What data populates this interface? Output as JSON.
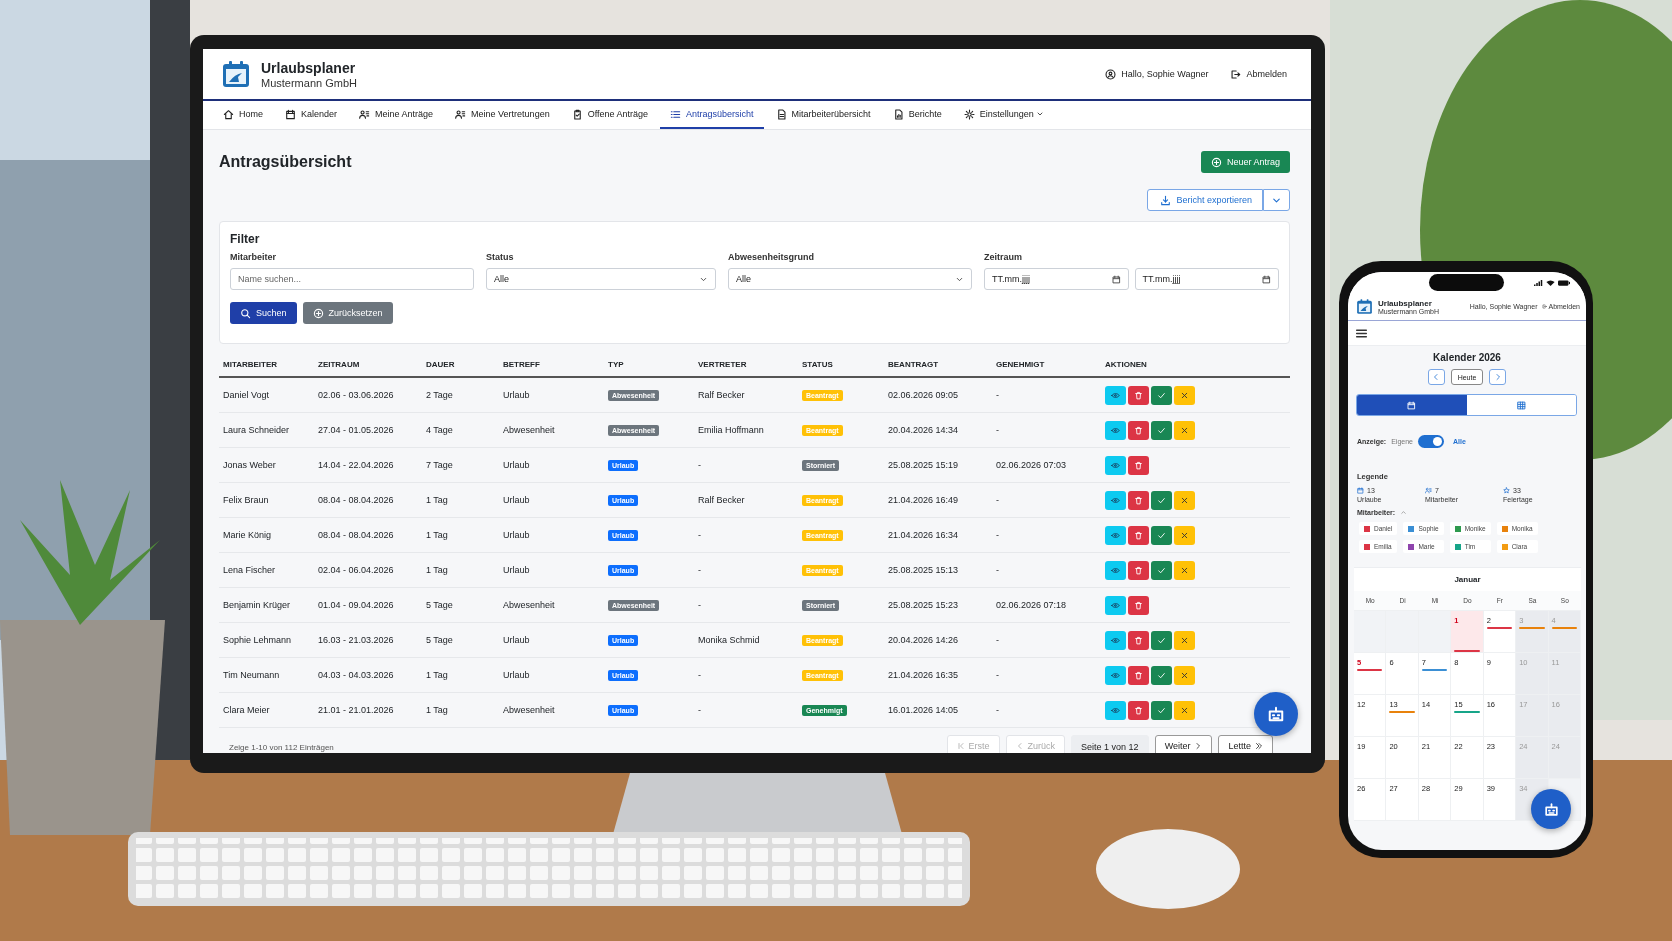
{
  "app": {
    "title": "Urlaubsplaner",
    "company": "Mustermann GmbH",
    "greeting": "Hallo, Sophie Wagner",
    "logout": "Abmelden"
  },
  "nav": [
    {
      "label": "Home",
      "selected": false,
      "dropdown": false
    },
    {
      "label": "Kalender",
      "selected": false,
      "dropdown": false
    },
    {
      "label": "Meine Anträge",
      "selected": false,
      "dropdown": false
    },
    {
      "label": "Meine Vertretungen",
      "selected": false,
      "dropdown": false
    },
    {
      "label": "Offene Anträge",
      "selected": false,
      "dropdown": false
    },
    {
      "label": "Antragsübersicht",
      "selected": true,
      "dropdown": false
    },
    {
      "label": "Mitarbeiterübersicht",
      "selected": false,
      "dropdown": false
    },
    {
      "label": "Berichte",
      "selected": false,
      "dropdown": false
    },
    {
      "label": "Einstellungen",
      "selected": false,
      "dropdown": true
    }
  ],
  "page": {
    "title": "Antragsübersicht",
    "new_button": "Neuer Antrag",
    "export_button": "Bericht exportieren"
  },
  "filter": {
    "title": "Filter",
    "fields": [
      {
        "kind": "text",
        "label": "Mitarbeiter",
        "placeholder": "Name suchen..."
      },
      {
        "kind": "select",
        "label": "Status",
        "value": "Alle"
      },
      {
        "kind": "select",
        "label": "Abwesenheitsgrund",
        "value": "Alle"
      },
      {
        "kind": "daterange",
        "label": "Zeitraum",
        "from_placeholder": "TT.mm.jjjj",
        "to_placeholder": "TT.mm.jjjj"
      }
    ],
    "search_button": "Suchen",
    "reset_button": "Zurücksetzen"
  },
  "table": {
    "columns": [
      "MITARBEITER",
      "ZEITRAUM",
      "DAUER",
      "BETREFF",
      "TYP",
      "VERTRETER",
      "STATUS",
      "BEANTRAGT",
      "GENEHMIGT",
      "AKTIONEN"
    ],
    "rows": [
      {
        "mitarbeiter": "Daniel Vogt",
        "zeitraum": "02.06 - 03.06.2026",
        "dauer": "2 Tage",
        "betreff": "Urlaub",
        "typ": {
          "label": "Abwesenheit",
          "color": "#6c757d"
        },
        "vertreter": "Ralf Becker",
        "status": {
          "label": "Beantragt",
          "color": "#ffc107"
        },
        "beantragt": "02.06.2026 09:05",
        "genehmigt": "-",
        "actions": [
          {
            "kind": "view"
          },
          {
            "kind": "delete"
          },
          {
            "kind": "approve"
          },
          {
            "kind": "reject"
          }
        ]
      },
      {
        "mitarbeiter": "Laura Schneider",
        "zeitraum": "27.04 - 01.05.2026",
        "dauer": "4 Tage",
        "betreff": "Abwesenheit",
        "typ": {
          "label": "Abwesenheit",
          "color": "#6c757d"
        },
        "vertreter": "Emilia Hoffmann",
        "status": {
          "label": "Beantragt",
          "color": "#ffc107"
        },
        "beantragt": "20.04.2026 14:34",
        "genehmigt": "-",
        "actions": [
          {
            "kind": "view"
          },
          {
            "kind": "delete"
          },
          {
            "kind": "approve"
          },
          {
            "kind": "reject"
          }
        ]
      },
      {
        "mitarbeiter": "Jonas Weber",
        "zeitraum": "14.04 - 22.04.2026",
        "dauer": "7 Tage",
        "betreff": "Urlaub",
        "typ": {
          "label": "Urlaub",
          "color": "#0d6efd"
        },
        "vertreter": "-",
        "status": {
          "label": "Storniert",
          "color": "#6c757d"
        },
        "beantragt": "25.08.2025 15:19",
        "genehmigt": "02.06.2026 07:03",
        "actions": [
          {
            "kind": "view"
          },
          {
            "kind": "delete"
          }
        ]
      },
      {
        "mitarbeiter": "Felix Braun",
        "zeitraum": "08.04 - 08.04.2026",
        "dauer": "1 Tag",
        "betreff": "Urlaub",
        "typ": {
          "label": "Urlaub",
          "color": "#0d6efd"
        },
        "vertreter": "Ralf Becker",
        "status": {
          "label": "Beantragt",
          "color": "#ffc107"
        },
        "beantragt": "21.04.2026 16:49",
        "genehmigt": "-",
        "actions": [
          {
            "kind": "view"
          },
          {
            "kind": "delete"
          },
          {
            "kind": "approve"
          },
          {
            "kind": "reject"
          }
        ]
      },
      {
        "mitarbeiter": "Marie König",
        "zeitraum": "08.04 - 08.04.2026",
        "dauer": "1 Tag",
        "betreff": "Urlaub",
        "typ": {
          "label": "Urlaub",
          "color": "#0d6efd"
        },
        "vertreter": "-",
        "status": {
          "label": "Beantragt",
          "color": "#ffc107"
        },
        "beantragt": "21.04.2026 16:34",
        "genehmigt": "-",
        "actions": [
          {
            "kind": "view"
          },
          {
            "kind": "delete"
          },
          {
            "kind": "approve"
          },
          {
            "kind": "reject"
          }
        ]
      },
      {
        "mitarbeiter": "Lena Fischer",
        "zeitraum": "02.04 - 06.04.2026",
        "dauer": "1 Tag",
        "betreff": "Urlaub",
        "typ": {
          "label": "Urlaub",
          "color": "#0d6efd"
        },
        "vertreter": "-",
        "status": {
          "label": "Beantragt",
          "color": "#ffc107"
        },
        "beantragt": "25.08.2025 15:13",
        "genehmigt": "-",
        "actions": [
          {
            "kind": "view"
          },
          {
            "kind": "delete"
          },
          {
            "kind": "approve"
          },
          {
            "kind": "reject"
          }
        ]
      },
      {
        "mitarbeiter": "Benjamin Krüger",
        "zeitraum": "01.04 - 09.04.2026",
        "dauer": "5 Tage",
        "betreff": "Abwesenheit",
        "typ": {
          "label": "Abwesenheit",
          "color": "#6c757d"
        },
        "vertreter": "-",
        "status": {
          "label": "Storniert",
          "color": "#6c757d"
        },
        "beantragt": "25.08.2025 15:23",
        "genehmigt": "02.06.2026 07:18",
        "actions": [
          {
            "kind": "view"
          },
          {
            "kind": "delete"
          }
        ]
      },
      {
        "mitarbeiter": "Sophie Lehmann",
        "zeitraum": "16.03 - 21.03.2026",
        "dauer": "5 Tage",
        "betreff": "Urlaub",
        "typ": {
          "label": "Urlaub",
          "color": "#0d6efd"
        },
        "vertreter": "Monika Schmid",
        "status": {
          "label": "Beantragt",
          "color": "#ffc107"
        },
        "beantragt": "20.04.2026 14:26",
        "genehmigt": "-",
        "actions": [
          {
            "kind": "view"
          },
          {
            "kind": "delete"
          },
          {
            "kind": "approve"
          },
          {
            "kind": "reject"
          }
        ]
      },
      {
        "mitarbeiter": "Tim Neumann",
        "zeitraum": "04.03 - 04.03.2026",
        "dauer": "1 Tag",
        "betreff": "Urlaub",
        "typ": {
          "label": "Urlaub",
          "color": "#0d6efd"
        },
        "vertreter": "-",
        "status": {
          "label": "Beantragt",
          "color": "#ffc107"
        },
        "beantragt": "21.04.2026 16:35",
        "genehmigt": "-",
        "actions": [
          {
            "kind": "view"
          },
          {
            "kind": "delete"
          },
          {
            "kind": "approve"
          },
          {
            "kind": "reject"
          }
        ]
      },
      {
        "mitarbeiter": "Clara Meier",
        "zeitraum": "21.01 - 21.01.2026",
        "dauer": "1 Tag",
        "betreff": "Abwesenheit",
        "typ": {
          "label": "Urlaub",
          "color": "#0d6efd"
        },
        "vertreter": "-",
        "status": {
          "label": "Genehmigt",
          "color": "#198754"
        },
        "beantragt": "16.01.2026 14:05",
        "genehmigt": "-",
        "actions": [
          {
            "kind": "view"
          },
          {
            "kind": "delete"
          },
          {
            "kind": "approve"
          },
          {
            "kind": "reject"
          }
        ]
      }
    ]
  },
  "pagination": {
    "info": "Zeige 1-10 von 112 Einträgen",
    "items": [
      {
        "kind": "first",
        "label": "Erste",
        "disabled": true
      },
      {
        "kind": "prev",
        "label": "Zurück",
        "disabled": true
      },
      {
        "kind": "page",
        "label": "Seite 1 von 12",
        "disabled": false
      },
      {
        "kind": "next",
        "label": "Weiter",
        "disabled": false
      },
      {
        "kind": "last",
        "label": "Lettte",
        "disabled": false
      }
    ]
  },
  "phone": {
    "title": "Urlaubsplaner",
    "company": "Mustermann GmbH",
    "greeting": "Hallo, Sophie Wagner",
    "logout": "Abmelden",
    "calendar_title": "Kalender 2026",
    "today": "Heute",
    "views": [
      {
        "selected": true
      },
      {
        "selected": false
      }
    ],
    "display": {
      "label": "Anzeige:",
      "off": "Eigene",
      "on": "Alle",
      "checked": true
    },
    "legend": {
      "title": "Legende",
      "stats": [
        {
          "count": "13",
          "label": "Urlaube"
        },
        {
          "count": "7",
          "label": "Mitarbeiter"
        },
        {
          "count": "33",
          "label": "Feiertage"
        }
      ],
      "employees_label": "Mitarbeiter:",
      "expanded": true,
      "employees": [
        {
          "name": "Daniel",
          "color": "#dc3545"
        },
        {
          "name": "Sophie",
          "color": "#3b8fd4"
        },
        {
          "name": "Monike",
          "color": "#2e9a4e"
        },
        {
          "name": "Monika",
          "color": "#e8820c"
        },
        {
          "name": "Emilia",
          "color": "#dc3545"
        },
        {
          "name": "Marie",
          "color": "#8e44ad"
        },
        {
          "name": "Tim",
          "color": "#17a589"
        },
        {
          "name": "Clara",
          "color": "#f39c12"
        }
      ]
    },
    "month": "Januar",
    "weekdays": [
      "Mo",
      "Di",
      "Mi",
      "Do",
      "Fr",
      "Sa",
      "So"
    ],
    "weeks": [
      [
        {
          "day": "1",
          "weekend": false,
          "holiday": true,
          "selected": true,
          "color": "#dc3545"
        },
        {
          "day": "2",
          "weekend": false,
          "holiday": false,
          "selected": false,
          "color": "#dc3545"
        },
        {
          "day": "3",
          "weekend": true,
          "holiday": false,
          "selected": false,
          "color": "#e8820c"
        },
        {
          "day": "4",
          "weekend": true,
          "holiday": false,
          "selected": false,
          "color": "#e8820c"
        }
      ],
      [
        {
          "day": "5",
          "weekend": false,
          "holiday": true,
          "selected": false,
          "color": "#dc3545"
        },
        {
          "day": "6",
          "weekend": false,
          "holiday": false,
          "selected": false
        },
        {
          "day": "7",
          "weekend": false,
          "holiday": false,
          "selected": false,
          "color": "#3b8fd4"
        },
        {
          "day": "8",
          "weekend": false,
          "holiday": false,
          "selected": false
        },
        {
          "day": "9",
          "weekend": false,
          "holiday": false,
          "selected": false
        },
        {
          "day": "10",
          "weekend": true,
          "holiday": false,
          "selected": false
        },
        {
          "day": "11",
          "weekend": true,
          "holiday": false,
          "selected": false
        }
      ],
      [
        {
          "day": "12",
          "weekend": false,
          "holiday": false,
          "selected": false
        },
        {
          "day": "13",
          "weekend": false,
          "holiday": false,
          "selected": false,
          "color": "#e8820c"
        },
        {
          "day": "14",
          "weekend": false,
          "holiday": false,
          "selected": false
        },
        {
          "day": "15",
          "weekend": false,
          "holiday": false,
          "selected": false,
          "color": "#17a589"
        },
        {
          "day": "16",
          "weekend": false,
          "holiday": false,
          "selected": false
        },
        {
          "day": "17",
          "weekend": true,
          "holiday": false,
          "selected": false
        },
        {
          "day": "16",
          "weekend": true,
          "holiday": false,
          "selected": false
        }
      ],
      [
        {
          "day": "19",
          "weekend": false,
          "holiday": false,
          "selected": false
        },
        {
          "day": "20",
          "weekend": false,
          "holiday": false,
          "selected": false
        },
        {
          "day": "21",
          "weekend": false,
          "holiday": false,
          "selected": false
        },
        {
          "day": "22",
          "weekend": false,
          "holiday": false,
          "selected": false
        },
        {
          "day": "23",
          "weekend": false,
          "holiday": false,
          "selected": false
        },
        {
          "day": "24",
          "weekend": true,
          "holiday": false,
          "selected": false
        },
        {
          "day": "24",
          "weekend": true,
          "holiday": false,
          "selected": false
        }
      ],
      [
        {
          "day": "26",
          "weekend": false,
          "holiday": false,
          "selected": false
        },
        {
          "day": "27",
          "weekend": false,
          "holiday": false,
          "selected": false
        },
        {
          "day": "28",
          "weekend": false,
          "holiday": false,
          "selected": false
        },
        {
          "day": "29",
          "weekend": false,
          "holiday": false,
          "selected": false
        },
        {
          "day": "39",
          "weekend": false,
          "holiday": false,
          "selected": false
        },
        {
          "day": "34",
          "weekend": true,
          "holiday": false,
          "selected": false
        }
      ]
    ]
  }
}
